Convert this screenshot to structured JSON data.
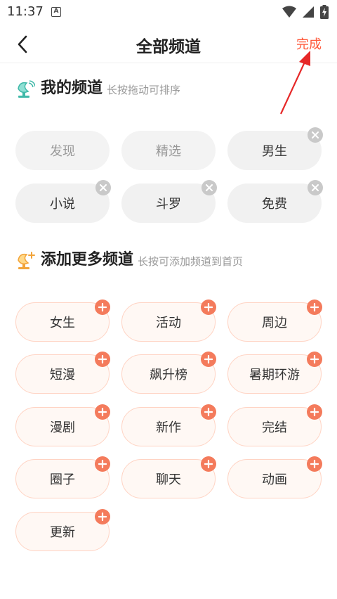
{
  "status_bar": {
    "time": "11:37",
    "notification_badge": "A"
  },
  "nav": {
    "title": "全部频道",
    "done_label": "完成"
  },
  "my_channels": {
    "title": "我的频道",
    "hint": "长按拖动可排序",
    "items": [
      {
        "label": "发现",
        "removable": false
      },
      {
        "label": "精选",
        "removable": false
      },
      {
        "label": "男生",
        "removable": true
      },
      {
        "label": "小说",
        "removable": true
      },
      {
        "label": "斗罗",
        "removable": true
      },
      {
        "label": "免费",
        "removable": true
      }
    ]
  },
  "more_channels": {
    "title": "添加更多频道",
    "hint": "长按可添加频道到首页",
    "items": [
      {
        "label": "女生"
      },
      {
        "label": "活动"
      },
      {
        "label": "周边"
      },
      {
        "label": "短漫"
      },
      {
        "label": "飙升榜"
      },
      {
        "label": "暑期环游"
      },
      {
        "label": "漫剧"
      },
      {
        "label": "新作"
      },
      {
        "label": "完结"
      },
      {
        "label": "圈子"
      },
      {
        "label": "聊天"
      },
      {
        "label": "动画"
      },
      {
        "label": "更新"
      }
    ]
  },
  "colors": {
    "accent": "#ff5a3c",
    "add_badge": "#f47b5c",
    "remove_badge": "#c9c9c9"
  }
}
